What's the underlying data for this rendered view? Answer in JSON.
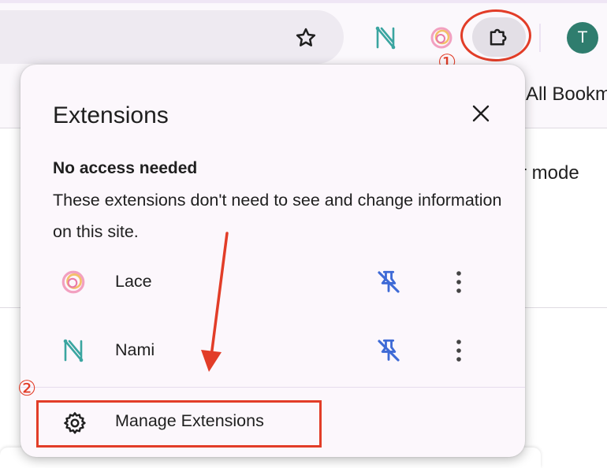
{
  "toolbar": {
    "avatar_initial": "T",
    "bookmarks_text": "All Bookm",
    "page_text": "r mode"
  },
  "popup": {
    "title": "Extensions",
    "section": {
      "heading": "No access needed",
      "description": "These extensions don't need to see and change information on this site."
    },
    "extensions": [
      {
        "name": "Lace",
        "icon": "lace-icon"
      },
      {
        "name": "Nami",
        "icon": "nami-icon"
      }
    ],
    "manage_label": "Manage Extensions"
  },
  "annotations": {
    "marker_1": "①",
    "marker_2": "②",
    "color": "#e23d28"
  },
  "colors": {
    "pin_blue": "#3e6ad6",
    "nami_teal": "#3aa5a0",
    "avatar": "#2f7d6e"
  }
}
